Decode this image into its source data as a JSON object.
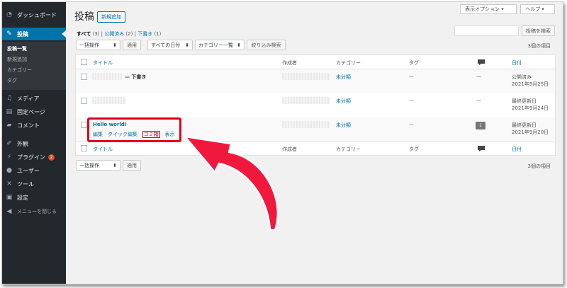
{
  "sidebar": {
    "dashboard": "ダッシュボード",
    "posts": "投稿",
    "sub": [
      "投稿一覧",
      "新規追加",
      "カテゴリー",
      "タグ"
    ],
    "media": "メディア",
    "pages": "固定ページ",
    "comments": "コメント",
    "appearance": "外観",
    "plugins": "プラグイン",
    "plugins_badge": "2",
    "users": "ユーザー",
    "tools": "ツール",
    "settings": "設定",
    "collapse": "メニューを閉じる"
  },
  "header": {
    "title": "投稿",
    "add_new": "新規追加",
    "screen_options": "表示オプション ▾",
    "help": "ヘルプ ▾"
  },
  "views": {
    "all": "すべて",
    "all_count": "(3)",
    "published": "公開済み",
    "published_count": "(2)",
    "draft": "下書き",
    "draft_count": "(1)",
    "sep": "|"
  },
  "search": {
    "button": "投稿を検索"
  },
  "filters": {
    "bulk_action": "一括操作",
    "apply": "適用",
    "all_dates": "すべての日付",
    "category_all": "カテゴリー一覧",
    "filter_button": "絞り込み検索",
    "items_count": "3個の項目"
  },
  "table": {
    "headers": {
      "title": "タイトル",
      "author": "作成者",
      "categories": "カテゴリー",
      "tags": "タグ",
      "date": "日付"
    },
    "rows": [
      {
        "title_suffix": "— 下書き",
        "category": "未分類",
        "tags": "—",
        "comments": "—",
        "date_status": "公開済み",
        "date": "2021年9月25日"
      },
      {
        "title_suffix": "",
        "category": "未分類",
        "tags": "—",
        "comments": "—",
        "date_status": "最終更新日",
        "date": "2021年9月24日"
      },
      {
        "title": "Hello world!",
        "category": "未分類",
        "tags": "—",
        "comments": "1",
        "date_status": "最終更新日",
        "date": "2021年9月20日",
        "actions": {
          "edit": "編集",
          "quick_edit": "クイック編集",
          "trash": "ゴミ箱",
          "view": "表示",
          "sep": "|"
        }
      }
    ]
  },
  "colors": {
    "accent": "#0073aa",
    "sidebar": "#23282d",
    "highlight": "#e0001a",
    "arrow": "#f0183c"
  }
}
